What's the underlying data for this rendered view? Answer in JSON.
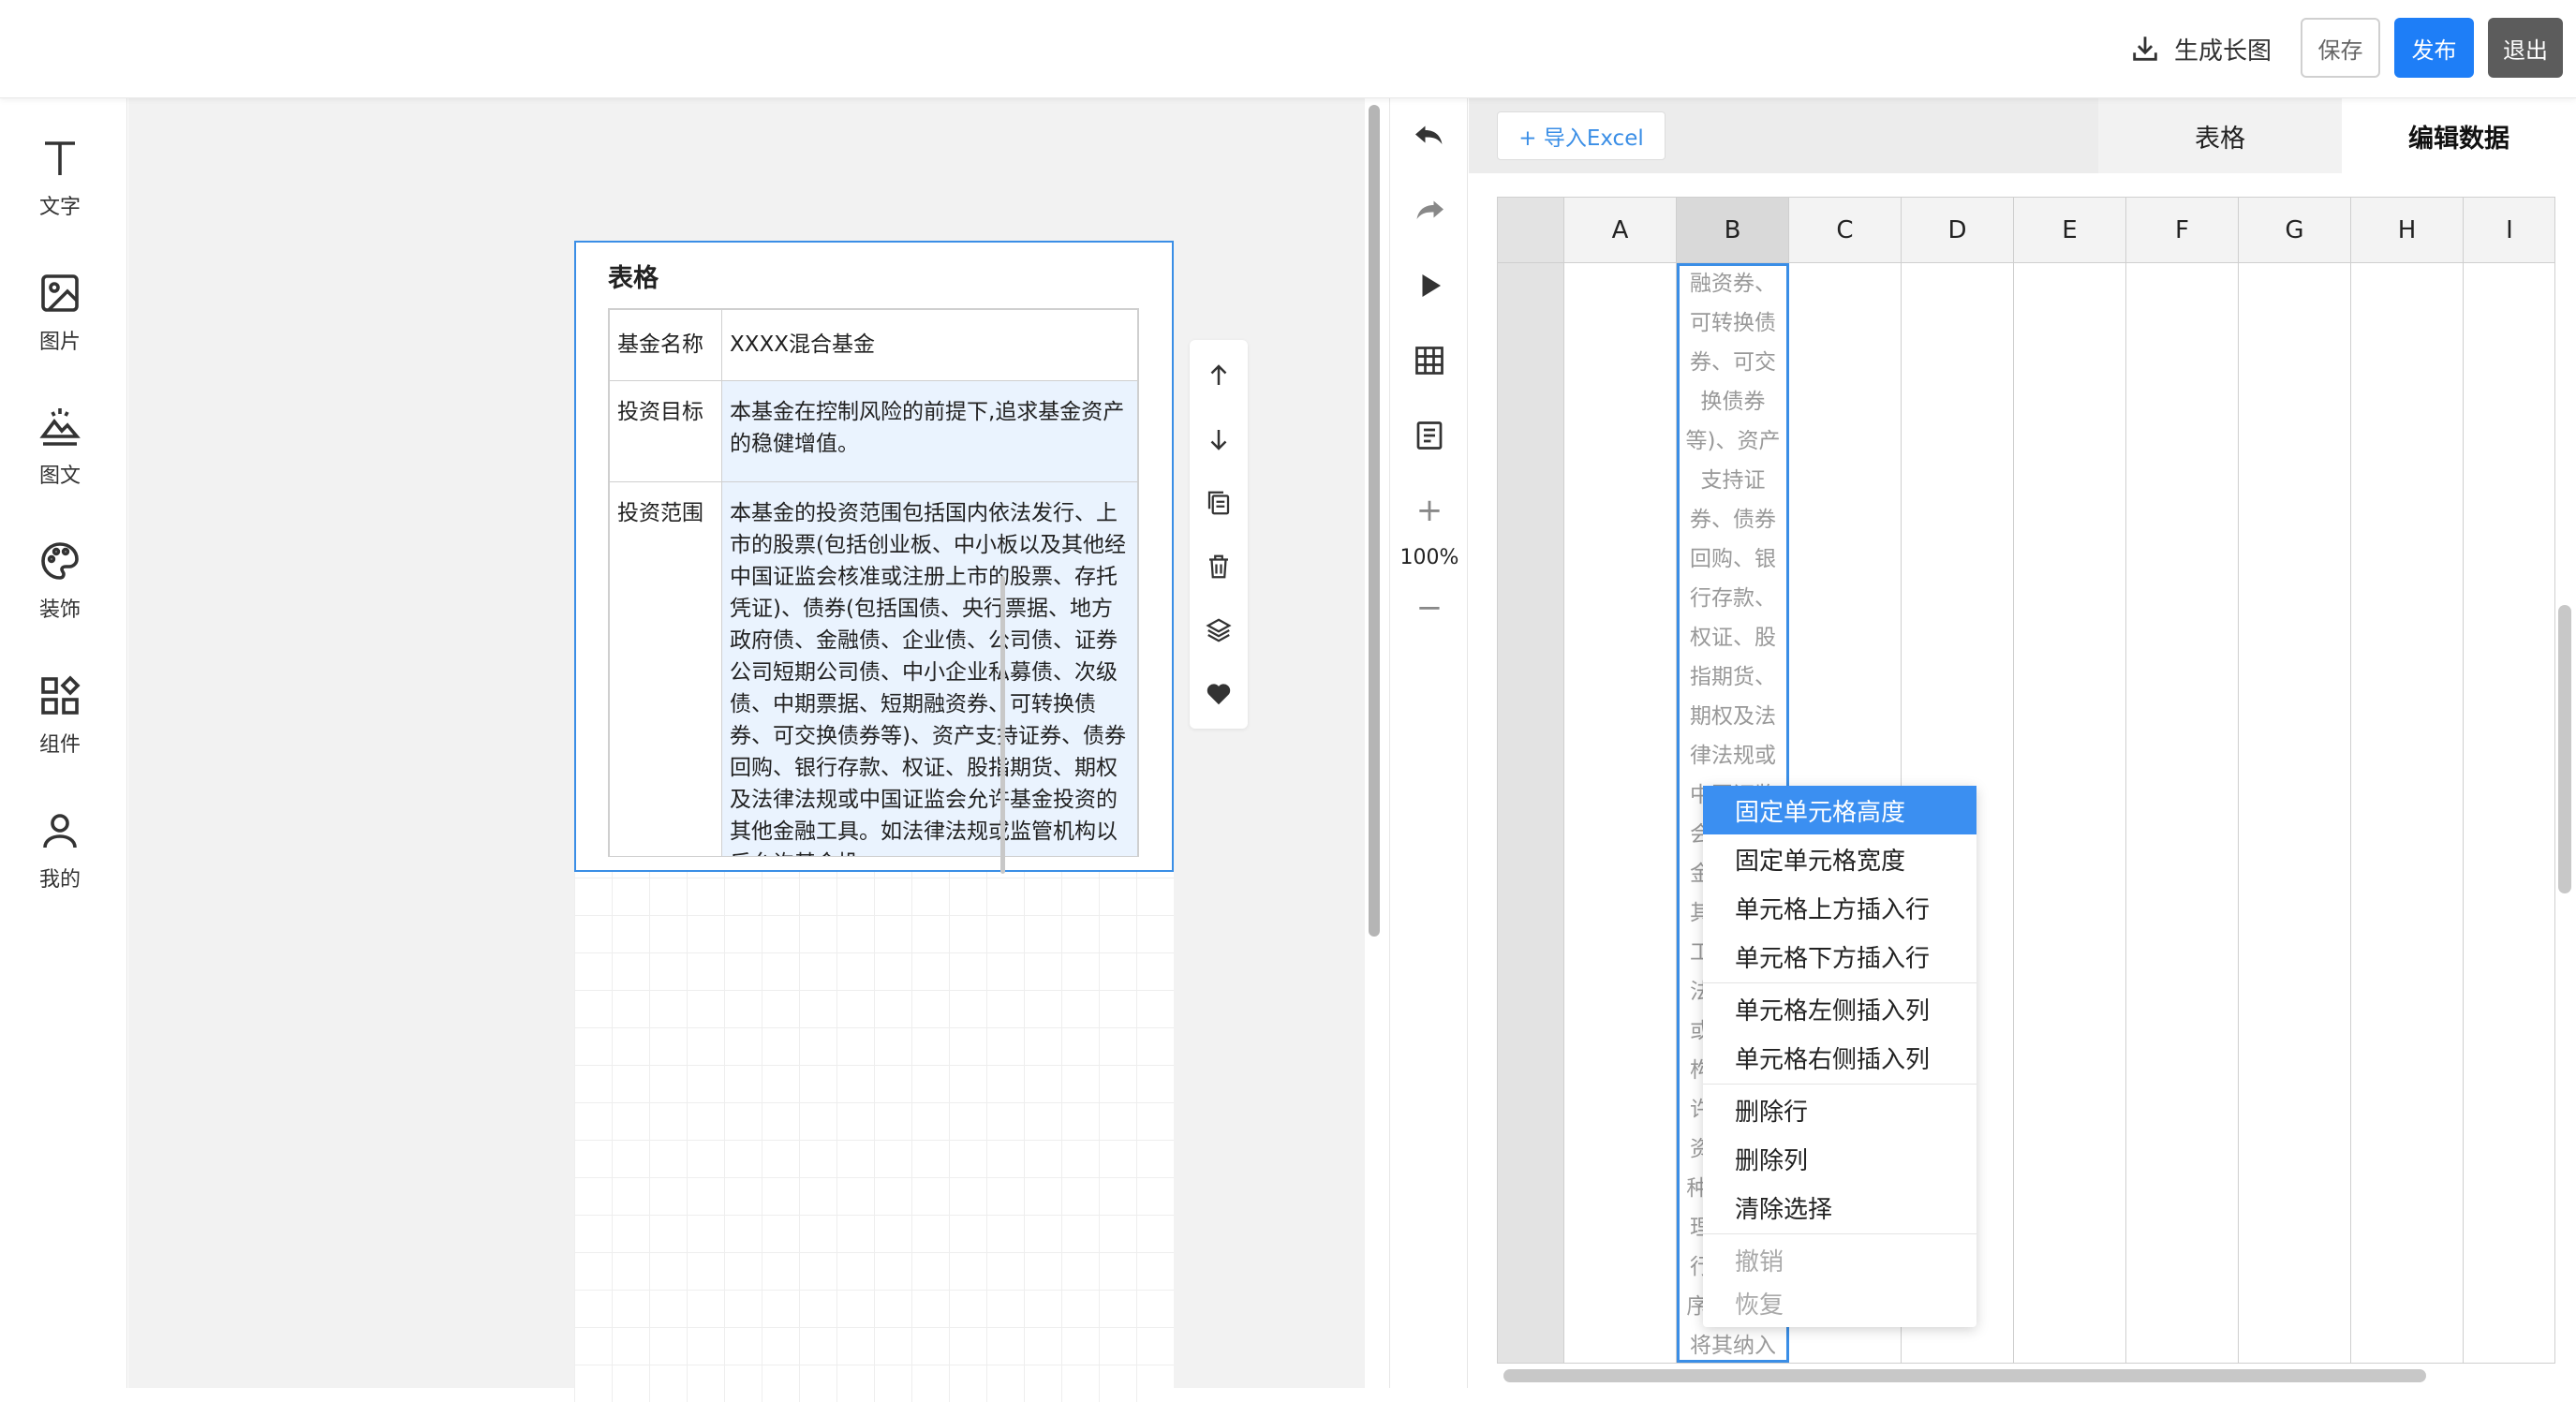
{
  "topbar": {
    "generate_label": "生成长图",
    "save_label": "保存",
    "publish_label": "发布",
    "exit_label": "退出"
  },
  "sidebar": {
    "items": [
      {
        "label": "文字",
        "icon": "text-icon"
      },
      {
        "label": "图片",
        "icon": "image-icon"
      },
      {
        "label": "图文",
        "icon": "image-text-icon"
      },
      {
        "label": "装饰",
        "icon": "palette-icon"
      },
      {
        "label": "组件",
        "icon": "components-icon"
      },
      {
        "label": "我的",
        "icon": "user-icon"
      }
    ]
  },
  "widget": {
    "title": "表格",
    "rows": [
      {
        "label": "基金名称",
        "value": "XXXX混合基金"
      },
      {
        "label": "投资目标",
        "value": "本基金在控制风险的前提下,追求基金资产的稳健增值。"
      },
      {
        "label": "投资范围",
        "value": "本基金的投资范围包括国内依法发行、上市的股票(包括创业板、中小板以及其他经中国证监会核准或注册上市的股票、存托凭证)、债券(包括国债、央行票据、地方政府债、金融债、企业债、公司债、证券公司短期公司债、中小企业私募债、次级债、中期票据、短期融资券、可转换债券、可交换债券等)、资产支持证券、债券回购、银行存款、权证、股指期货、期权及法律法规或中国证监会允许基金投资的其他金融工具。如法律法规或监管机构以后允许基金投"
      }
    ]
  },
  "widget_tools": [
    "arrow-up-icon",
    "arrow-down-icon",
    "copy-icon",
    "trash-icon",
    "layers-icon",
    "heart-icon"
  ],
  "midtools": {
    "zoom": "100%",
    "zoom_in": "+",
    "zoom_out": "−"
  },
  "editor": {
    "import_label": "+ 导入Excel",
    "tabs": [
      "表格",
      "编辑数据"
    ],
    "columns": [
      "A",
      "B",
      "C",
      "D",
      "E",
      "F",
      "G",
      "H",
      "I"
    ],
    "selected_column": "B",
    "cell_text": "融资券、可转换债券、可交换债券等)、资产支持证券、债券回购、银行存款、权证、股指期货、期权及法律法规或中国证监会允许基金投资的其他金融工具。如法律法规或监管机构以后允许基金投资其他品种,基金管理人在履行适当程序后,可以将其纳入投资范围。"
  },
  "context_menu": {
    "items": [
      {
        "label": "固定单元格高度",
        "state": "active"
      },
      {
        "label": "固定单元格宽度",
        "state": "normal"
      },
      {
        "label": "单元格上方插入行",
        "state": "normal"
      },
      {
        "label": "单元格下方插入行",
        "state": "normal"
      },
      {
        "label": "单元格左侧插入列",
        "state": "normal"
      },
      {
        "label": "单元格右侧插入列",
        "state": "normal"
      },
      {
        "label": "删除行",
        "state": "normal"
      },
      {
        "label": "删除列",
        "state": "normal"
      },
      {
        "label": "清除选择",
        "state": "normal"
      },
      {
        "label": "撤销",
        "state": "disabled"
      },
      {
        "label": "恢复",
        "state": "disabled"
      }
    ]
  },
  "colors": {
    "accent": "#1e7ef7",
    "selection": "#3a8ee6",
    "menu_active": "#3b8ff1",
    "exit_button": "#5c5c5c"
  }
}
